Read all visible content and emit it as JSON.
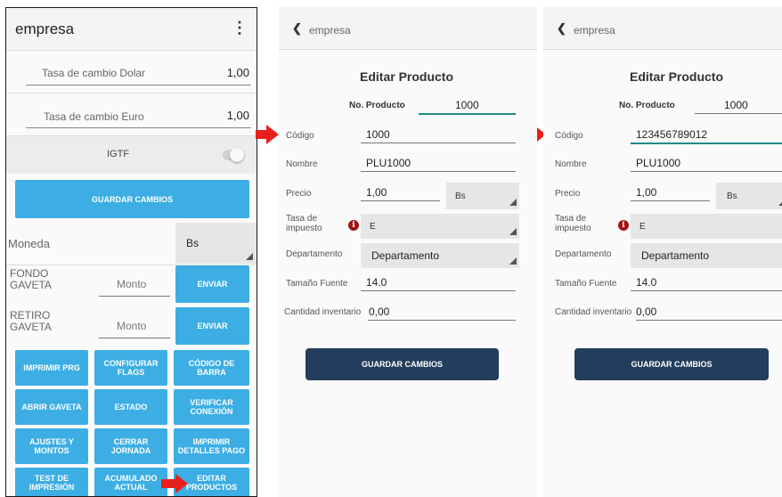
{
  "colors": {
    "accent": "#3caee4",
    "dark_button": "#233e5c",
    "arrow": "#e8201c",
    "info": "#a31414",
    "active_line": "#1d8a8a"
  },
  "screen1": {
    "title": "empresa",
    "menu_icon": "kebab-icon",
    "rate_dolar": {
      "label": "Tasa de cambio Dolar",
      "value": "1,00"
    },
    "rate_euro": {
      "label": "Tasa de cambio Euro",
      "value": "1,00"
    },
    "igtf_label": "IGTF",
    "save_label": "GUARDAR CAMBIOS",
    "currency": {
      "label": "Moneda",
      "value": "Bs"
    },
    "fondo": {
      "label": "FONDO\nGAVETA",
      "placeholder": "Monto",
      "button": "ENVIAR"
    },
    "retiro": {
      "label": "RETIRO\nGAVETA",
      "placeholder": "Monto",
      "button": "ENVIAR"
    },
    "grid": [
      "IMPRIMIR PRG",
      "CONFIGURAR FLAGS",
      "CÓDIGO DE BARRA",
      "ABRIR GAVETA",
      "ESTADO",
      "VERIFICAR CONEXIÓN",
      "AJUSTES Y MONTOS",
      "CERRAR JORNADA",
      "IMPRIMIR DETALLES PAGO",
      "TEST DE IMPRESIÓN",
      "ACUMULADO ACTUAL",
      "EDITAR PRODUCTOS"
    ]
  },
  "screen2": {
    "nav_title": "empresa",
    "form_title": "Editar Producto",
    "product_no": {
      "label": "No. Producto",
      "value": "1000"
    },
    "codigo": {
      "label": "Código",
      "value": "1000"
    },
    "nombre": {
      "label": "Nombre",
      "value": "PLU1000"
    },
    "precio": {
      "label": "Precio",
      "value": "1,00",
      "currency": "Bs"
    },
    "tasa": {
      "label": "Tasa de\nimpuesto",
      "value": "E"
    },
    "departamento": {
      "label": "Departamento",
      "value": "Departamento"
    },
    "fuente": {
      "label": "Tamaño Fuente",
      "value": "14.0"
    },
    "inventario": {
      "label": "Cantidad inventario",
      "value": "0,00"
    },
    "save_label": "GUARDAR CAMBIOS"
  },
  "screen3": {
    "nav_title": "empresa",
    "form_title": "Editar Producto",
    "product_no": {
      "label": "No. Producto",
      "value": "1000"
    },
    "codigo": {
      "label": "Código",
      "value": "123456789012"
    },
    "nombre": {
      "label": "Nombre",
      "value": "PLU1000"
    },
    "precio": {
      "label": "Precio",
      "value": "1,00",
      "currency": "Bs"
    },
    "tasa": {
      "label": "Tasa de\nimpuesto",
      "value": "E"
    },
    "departamento": {
      "label": "Departamento",
      "value": "Departamento"
    },
    "fuente": {
      "label": "Tamaño Fuente",
      "value": "14.0"
    },
    "inventario": {
      "label": "Cantidad inventario",
      "value": "0,00"
    },
    "save_label": "GUARDAR CAMBIOS"
  }
}
